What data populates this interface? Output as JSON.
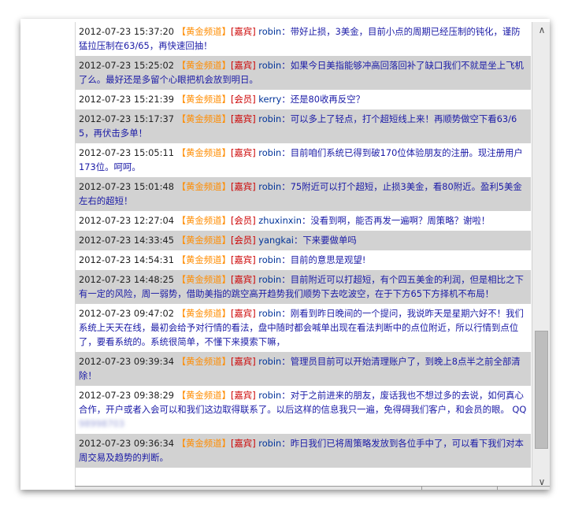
{
  "messages": [
    {
      "time": "2012-07-23 15:37:20",
      "channel": "【黄金频道】",
      "role": "[嘉宾]",
      "user": "robin",
      "text": "：带好止损，3美金，目前小点的周期已经压制的钝化，谨防猛拉压制在63/65，再快速回抽！",
      "shaded": false
    },
    {
      "time": "2012-07-23 15:25:02",
      "channel": "【黄金频道】",
      "role": "[嘉宾]",
      "user": "robin",
      "text": "：如果今日美指能够冲高回落回补了缺口我们不就是坐上飞机了么。最好还是多留个心眼把机会放到明日。",
      "shaded": true
    },
    {
      "time": "2012-07-23 15:21:39",
      "channel": "【黄金频道】",
      "role": "[会员]",
      "user": "kerry",
      "text": "：还是80收再反空？",
      "shaded": false
    },
    {
      "time": "2012-07-23 15:17:37",
      "channel": "【黄金频道】",
      "role": "[嘉宾]",
      "user": "robin",
      "text": "：可以多上了轻点，打个超短线上来！再顺势做空下看63/65，再伏击多单！",
      "shaded": true
    },
    {
      "time": "2012-07-23 15:05:11",
      "channel": "【黄金频道】",
      "role": "[嘉宾]",
      "user": "robin",
      "text": "：目前咱们系统已得到破170位体验朋友的注册。现注册用户173位。呵呵。",
      "shaded": false
    },
    {
      "time": "2012-07-23 15:01:48",
      "channel": "【黄金频道】",
      "role": "[嘉宾]",
      "user": "robin",
      "text": "：75附近可以打个超短，止损3美金，看80附近。盈利5美金左右的超短！",
      "shaded": true
    },
    {
      "time": "2012-07-23 12:27:04",
      "channel": "【黄金频道】",
      "role": "[会员]",
      "user": "zhuxinxin",
      "text": "：没看到啊，能否再发一遍啊？周策略？谢啦！",
      "shaded": false
    },
    {
      "time": "2012-07-23 14:33:45",
      "channel": "【黄金频道】",
      "role": "[会员]",
      "user": "yangkai",
      "text": "：下来要做单吗",
      "shaded": true
    },
    {
      "time": "2012-07-23 14:54:31",
      "channel": "【黄金频道】",
      "role": "[嘉宾]",
      "user": "robin",
      "text": "：目前的意思是观望!",
      "shaded": false
    },
    {
      "time": "2012-07-23 14:48:25",
      "channel": "【黄金频道】",
      "role": "[嘉宾]",
      "user": "robin",
      "text": "：目前附近可以打超短，有个四五美金的利润，但是相比之下有一定的风险，周一弱势，借助美指的跳空高开趋势我们顺势下去吃波空，在于下方65下方择机不布局！",
      "shaded": true
    },
    {
      "time": "2012-07-23 09:47:02",
      "channel": "【黄金频道】",
      "role": "[嘉宾]",
      "user": "robin",
      "text": "：刚看到昨日晚间的一个提问，我说昨天是星期六好不！我们系统上天天在线，最初会给予对行情的看法，盘中随时都会喊单出现在看法判断中的点位附近，所以行情到点位了，要看系统的。系统很简单，不懂下来摸索下嘛，",
      "shaded": false
    },
    {
      "time": "2012-07-23 09:39:34",
      "channel": "【黄金频道】",
      "role": "[嘉宾]",
      "user": "robin",
      "text": "：管理员目前可以开始清理账户了，到晚上8点半之前全部清除！",
      "shaded": true
    },
    {
      "time": "2012-07-23 09:38:29",
      "channel": "【黄金频道】",
      "role": "[嘉宾]",
      "user": "robin",
      "text": "：对于之前进来的朋友，废话我也不想过多的去说，如何真心合作，开户或者入会可以和我们这边取得联系了。以后这样的信息我只一遍，免得碍我们客户，和会员的眼。 QQ",
      "blurred": "98998703",
      "shaded": false
    },
    {
      "time": "2012-07-23 09:36:34",
      "channel": "【黄金频道】",
      "role": "[嘉宾]",
      "user": "robin",
      "text": "：昨日我们已将周策略发放到各位手中了，可以看下我们对本周交易及趋势的判断。",
      "shaded": true
    }
  ],
  "icons": {
    "scroll_up": "chevron-up-icon",
    "scroll_down": "chevron-down-icon"
  }
}
